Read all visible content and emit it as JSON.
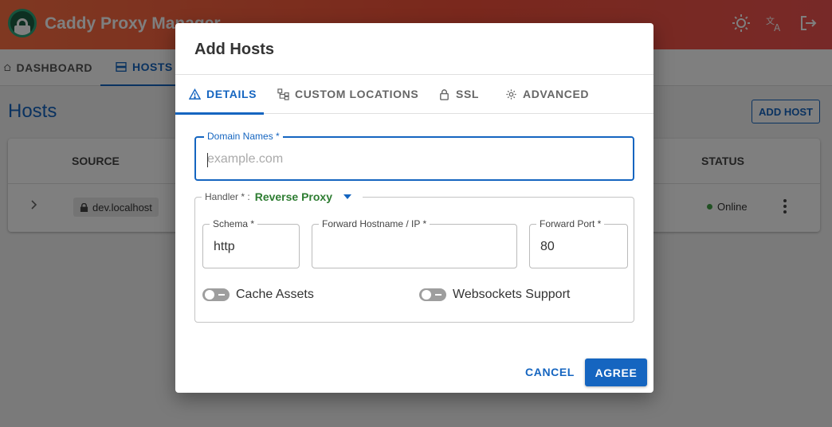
{
  "app": {
    "title": "Caddy Proxy Manager",
    "brand_color": "#f4513a",
    "accent_color": "#1565c0"
  },
  "nav": {
    "tabs": [
      {
        "label": "DASHBOARD",
        "icon": "home-icon",
        "active": false
      },
      {
        "label": "HOSTS",
        "icon": "server-icon",
        "active": true
      }
    ]
  },
  "page": {
    "title": "Hosts",
    "add_button": "ADD HOST"
  },
  "table": {
    "headers": {
      "source": "SOURCE",
      "status": "STATUS"
    },
    "rows": [
      {
        "source": "dev.localhost",
        "status": "Online",
        "status_color": "#43a047"
      }
    ]
  },
  "dialog": {
    "title": "Add Hosts",
    "tabs": [
      {
        "label": "DETAILS",
        "icon": "warning-icon",
        "active": true
      },
      {
        "label": "CUSTOM LOCATIONS",
        "icon": "sitemap-icon",
        "active": false
      },
      {
        "label": "SSL",
        "icon": "lock-icon",
        "active": false
      },
      {
        "label": "ADVANCED",
        "icon": "gear-icon",
        "active": false
      }
    ],
    "domain": {
      "label": "Domain Names *",
      "placeholder": "example.com",
      "value": ""
    },
    "handler": {
      "label": "Handler * :",
      "value": "Reverse Proxy"
    },
    "schema": {
      "label": "Schema *",
      "value": "http"
    },
    "forward_host": {
      "label": "Forward Hostname / IP *",
      "value": ""
    },
    "forward_port": {
      "label": "Forward Port *",
      "value": "80"
    },
    "cache_assets": {
      "label": "Cache Assets",
      "enabled": false
    },
    "websockets": {
      "label": "Websockets Support",
      "enabled": false
    },
    "cancel_label": "CANCEL",
    "agree_label": "AGREE"
  }
}
